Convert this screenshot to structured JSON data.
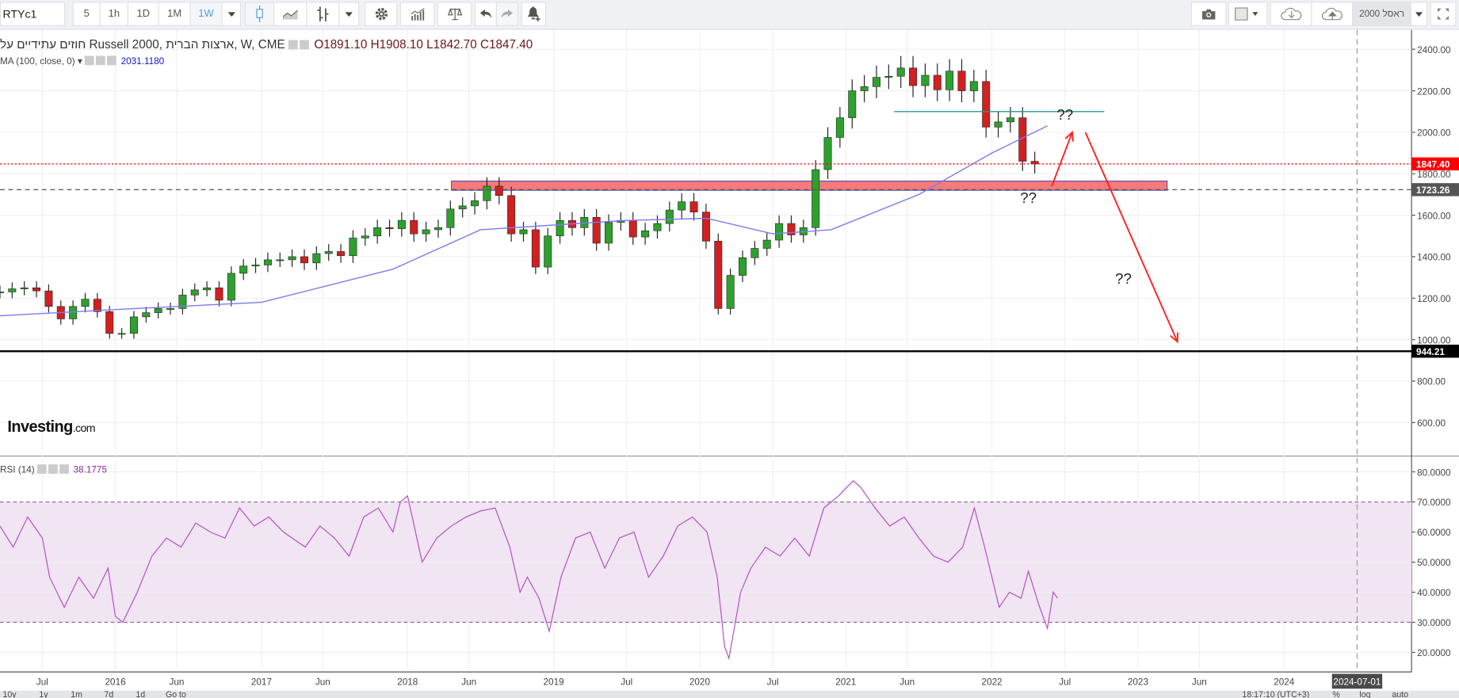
{
  "toolbar": {
    "symbol": "RTYc1",
    "intervals": [
      "5",
      "1h",
      "1D",
      "1M",
      "1W"
    ],
    "selected_interval": "1W",
    "instrument_name": "ראסל 2000",
    "icons": [
      "candles-icon",
      "area-chart-icon",
      "bars-icon",
      "gear-icon",
      "indicators-icon",
      "scales-icon",
      "undo-icon",
      "redo-icon",
      "alert-icon",
      "camera-icon",
      "color-box-icon",
      "cloud-download-icon",
      "cloud-upload-icon",
      "fullscreen-icon"
    ]
  },
  "legend": {
    "title": "חוזים עתידיים על Russell 2000, ארצות הברית, W, CME",
    "open": "O1891.10",
    "high": "H1908.10",
    "low": "L1842.70",
    "close": "C1847.40",
    "ma_label": "MA (100, close, 0)",
    "ma_value": "2031.1180",
    "rsi_label": "RSI (14)",
    "rsi_value": "38.1775"
  },
  "logo": {
    "brand": "Investing",
    "suffix": ".com"
  },
  "bottombar": {
    "ranges": [
      "10y",
      "1y",
      "1m",
      "7d",
      "1d"
    ],
    "goto": "Go to",
    "time": "18:17:10 (UTC+3)",
    "percent": "%",
    "log": "log",
    "auto": "auto"
  },
  "colors": {
    "up": "#2ea02e",
    "down": "#d02020",
    "ma": "#7b7bf0",
    "rsi": "#b050c0",
    "rsi_band": "#f1e4f3",
    "zone": "#f57a7a",
    "accent": "#4a9be0"
  },
  "chart_data": {
    "type": "candlestick",
    "price_axis": {
      "ticks": [
        600,
        800,
        1000,
        1200,
        1400,
        1600,
        1800,
        2000,
        2200,
        2400
      ],
      "ylim": [
        560,
        2450
      ]
    },
    "time_axis": {
      "ticks": [
        [
          "Jul",
          2015.5
        ],
        [
          "2016",
          2016
        ],
        [
          "Jun",
          2016.42
        ],
        [
          "2017",
          2017
        ],
        [
          "Jun",
          2017.42
        ],
        [
          "2018",
          2018
        ],
        [
          "Jun",
          2018.42
        ],
        [
          "2019",
          2019
        ],
        [
          "Jul",
          2019.5
        ],
        [
          "2020",
          2020
        ],
        [
          "Jul",
          2020.5
        ],
        [
          "2021",
          2021
        ],
        [
          "Jun",
          2021.42
        ],
        [
          "2022",
          2022
        ],
        [
          "Jul",
          2022.5
        ],
        [
          "2023",
          2023
        ],
        [
          "Jun",
          2023.42
        ],
        [
          "2024",
          2024
        ]
      ],
      "cursor_label": "2024-07-01",
      "cursor": 2024.5
    },
    "monthly_close": {
      "start": 2015.21,
      "values": [
        1230,
        1245,
        1250,
        1235,
        1160,
        1100,
        1160,
        1195,
        1135,
        1030,
        1030,
        1110,
        1130,
        1150,
        1150,
        1215,
        1240,
        1250,
        1190,
        1320,
        1355,
        1360,
        1385,
        1385,
        1400,
        1370,
        1415,
        1425,
        1405,
        1490,
        1500,
        1540,
        1535,
        1575,
        1510,
        1530,
        1540,
        1630,
        1645,
        1670,
        1740,
        1695,
        1510,
        1530,
        1350,
        1500,
        1575,
        1540,
        1590,
        1465,
        1565,
        1575,
        1495,
        1525,
        1560,
        1625,
        1665,
        1615,
        1475,
        1150,
        1310,
        1395,
        1440,
        1480,
        1560,
        1505,
        1540,
        1820,
        1975,
        2070,
        2200,
        2220,
        2265,
        2270,
        2310,
        2225,
        2275,
        2205,
        2295,
        2200,
        2245,
        2025,
        2050,
        2070,
        1860,
        1847.4
      ]
    },
    "ma100": [
      [
        2015.21,
        1115
      ],
      [
        2016,
        1145
      ],
      [
        2017,
        1180
      ],
      [
        2017.9,
        1340
      ],
      [
        2018.5,
        1530
      ],
      [
        2019.5,
        1575
      ],
      [
        2020.05,
        1585
      ],
      [
        2020.5,
        1510
      ],
      [
        2020.9,
        1530
      ],
      [
        2021.5,
        1700
      ],
      [
        2022,
        1900
      ],
      [
        2022.38,
        2031
      ]
    ],
    "price_labels": [
      {
        "value": 1847.4,
        "text": "1847.40",
        "color": "#ff0000",
        "style": "dotted"
      },
      {
        "value": 1723.26,
        "text": "1723.26",
        "color": "#555555",
        "style": "dashed"
      },
      {
        "value": 944.21,
        "text": "944.21",
        "color": "#000000",
        "style": "solid"
      }
    ],
    "zone": {
      "from": 2018.3,
      "to": 2023.2,
      "low": 1720,
      "high": 1765
    },
    "resistance": {
      "from": 2021.33,
      "to": 2022.77,
      "value": 2100
    },
    "arrows": [
      [
        [
          2022.41,
          1740
        ],
        [
          2022.55,
          2000
        ]
      ],
      [
        [
          2022.64,
          2000
        ],
        [
          2023.27,
          990
        ]
      ]
    ],
    "annotations": [
      {
        "text": "??",
        "x": 2022.5,
        "y": 2060
      },
      {
        "text": "??",
        "x": 2022.25,
        "y": 1660
      },
      {
        "text": "??",
        "x": 2022.9,
        "y": 1270
      }
    ],
    "rsi": {
      "ticks": [
        20,
        30,
        40,
        50,
        60,
        70,
        80
      ],
      "overbought": 70,
      "oversold": 30,
      "ylim": [
        12,
        84
      ],
      "points": [
        [
          2015.21,
          62
        ],
        [
          2015.3,
          55
        ],
        [
          2015.4,
          65
        ],
        [
          2015.5,
          58
        ],
        [
          2015.55,
          45
        ],
        [
          2015.65,
          35
        ],
        [
          2015.75,
          45
        ],
        [
          2015.85,
          38
        ],
        [
          2015.95,
          48
        ],
        [
          2016,
          32
        ],
        [
          2016.05,
          30
        ],
        [
          2016.15,
          40
        ],
        [
          2016.25,
          52
        ],
        [
          2016.35,
          58
        ],
        [
          2016.45,
          55
        ],
        [
          2016.55,
          63
        ],
        [
          2016.65,
          60
        ],
        [
          2016.75,
          58
        ],
        [
          2016.85,
          68
        ],
        [
          2016.95,
          62
        ],
        [
          2017.05,
          65
        ],
        [
          2017.15,
          60
        ],
        [
          2017.3,
          55
        ],
        [
          2017.4,
          62
        ],
        [
          2017.5,
          58
        ],
        [
          2017.6,
          52
        ],
        [
          2017.7,
          65
        ],
        [
          2017.8,
          68
        ],
        [
          2017.9,
          60
        ],
        [
          2017.95,
          70
        ],
        [
          2018,
          72
        ],
        [
          2018.1,
          50
        ],
        [
          2018.2,
          58
        ],
        [
          2018.3,
          62
        ],
        [
          2018.4,
          65
        ],
        [
          2018.5,
          67
        ],
        [
          2018.6,
          68
        ],
        [
          2018.7,
          55
        ],
        [
          2018.77,
          40
        ],
        [
          2018.82,
          45
        ],
        [
          2018.9,
          38
        ],
        [
          2018.97,
          27
        ],
        [
          2019.05,
          45
        ],
        [
          2019.15,
          58
        ],
        [
          2019.25,
          60
        ],
        [
          2019.35,
          48
        ],
        [
          2019.45,
          58
        ],
        [
          2019.55,
          60
        ],
        [
          2019.65,
          45
        ],
        [
          2019.75,
          52
        ],
        [
          2019.85,
          62
        ],
        [
          2019.95,
          65
        ],
        [
          2020.05,
          60
        ],
        [
          2020.12,
          45
        ],
        [
          2020.17,
          22
        ],
        [
          2020.2,
          18
        ],
        [
          2020.28,
          40
        ],
        [
          2020.35,
          48
        ],
        [
          2020.45,
          55
        ],
        [
          2020.55,
          52
        ],
        [
          2020.65,
          58
        ],
        [
          2020.75,
          52
        ],
        [
          2020.85,
          68
        ],
        [
          2020.95,
          72
        ],
        [
          2021.05,
          77
        ],
        [
          2021.1,
          75
        ],
        [
          2021.2,
          68
        ],
        [
          2021.3,
          62
        ],
        [
          2021.4,
          65
        ],
        [
          2021.5,
          58
        ],
        [
          2021.6,
          52
        ],
        [
          2021.7,
          50
        ],
        [
          2021.8,
          55
        ],
        [
          2021.88,
          68
        ],
        [
          2021.95,
          55
        ],
        [
          2022,
          45
        ],
        [
          2022.05,
          35
        ],
        [
          2022.12,
          40
        ],
        [
          2022.2,
          38
        ],
        [
          2022.25,
          47
        ],
        [
          2022.32,
          36
        ],
        [
          2022.38,
          28
        ],
        [
          2022.42,
          40
        ],
        [
          2022.45,
          38
        ]
      ]
    }
  }
}
